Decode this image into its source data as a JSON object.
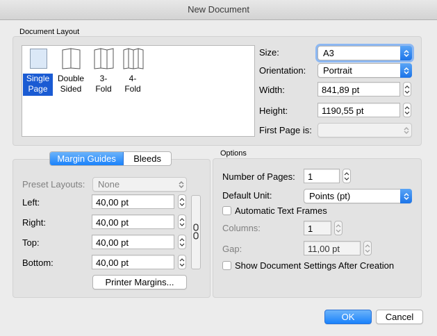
{
  "window": {
    "title": "New Document"
  },
  "document_layout": {
    "group_label": "Document Layout",
    "layouts": [
      {
        "label_line1": "Single",
        "label_line2": "Page",
        "selected": true
      },
      {
        "label_line1": "Double",
        "label_line2": "Sided",
        "selected": false
      },
      {
        "label_line1": "3-",
        "label_line2": "Fold",
        "selected": false
      },
      {
        "label_line1": "4-",
        "label_line2": "Fold",
        "selected": false
      }
    ],
    "size_label": "Size:",
    "size_value": "A3",
    "orientation_label": "Orientation:",
    "orientation_value": "Portrait",
    "width_label": "Width:",
    "width_value": "841,89 pt",
    "height_label": "Height:",
    "height_value": "1190,55 pt",
    "first_page_label": "First Page is:",
    "first_page_value": ""
  },
  "margins": {
    "tabs": [
      {
        "label": "Margin Guides",
        "selected": true
      },
      {
        "label": "Bleeds",
        "selected": false
      }
    ],
    "preset_label": "Preset Layouts:",
    "preset_value": "None",
    "left_label": "Left:",
    "left_value": "40,00 pt",
    "right_label": "Right:",
    "right_value": "40,00 pt",
    "top_label": "Top:",
    "top_value": "40,00 pt",
    "bottom_label": "Bottom:",
    "bottom_value": "40,00 pt",
    "printer_margins_label": "Printer Margins..."
  },
  "options": {
    "group_label": "Options",
    "pages_label": "Number of Pages:",
    "pages_value": "1",
    "unit_label": "Default Unit:",
    "unit_value": "Points (pt)",
    "auto_frames_label": "Automatic Text Frames",
    "auto_frames_checked": false,
    "columns_label": "Columns:",
    "columns_value": "1",
    "gap_label": "Gap:",
    "gap_value": "11,00 pt",
    "show_settings_label": "Show Document Settings After Creation",
    "show_settings_checked": false
  },
  "buttons": {
    "ok_label": "OK",
    "cancel_label": "Cancel"
  },
  "colors": {
    "accent": "#1a82fb",
    "window_bg": "#ececec",
    "group_bg": "#e3e3e3"
  }
}
